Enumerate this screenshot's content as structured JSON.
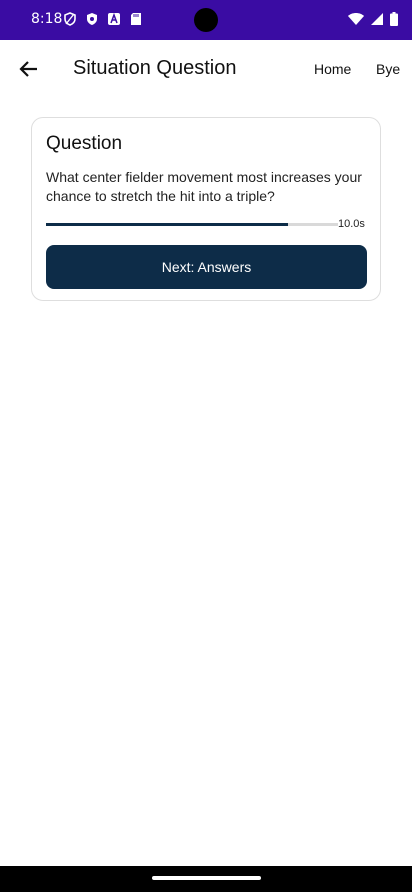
{
  "status_bar": {
    "time": "8:18",
    "left_icons": [
      "shield-icon",
      "security-badge-icon",
      "a-badge-icon",
      "sd-card-icon"
    ],
    "right_icons": [
      "wifi-icon",
      "signal-icon",
      "battery-icon"
    ],
    "background": "#3a0ca3"
  },
  "top_bar": {
    "title": "Situation Question",
    "nav": {
      "home": "Home",
      "bye": "Bye"
    }
  },
  "question_card": {
    "heading": "Question",
    "question": "What center fielder movement most increases your chance to stretch the hit into a triple?",
    "timer": {
      "label": "10.0s",
      "progress": 0.83
    },
    "next_button": "Next: Answers",
    "accent": "#0d2c48"
  }
}
